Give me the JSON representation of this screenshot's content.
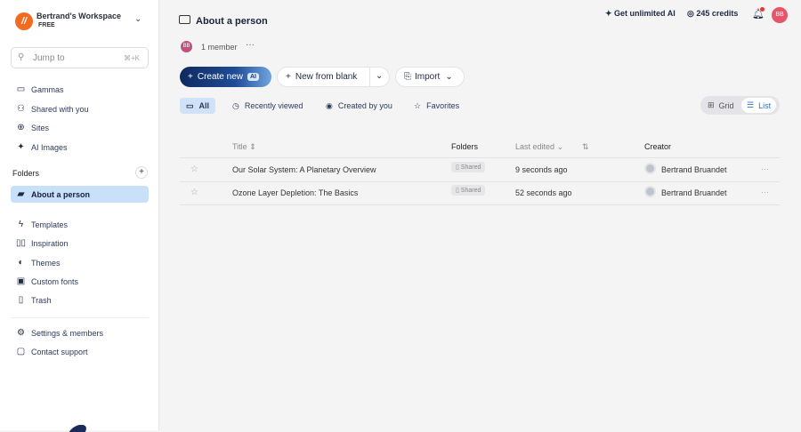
{
  "workspace": {
    "name": "Bertrand's Workspace",
    "plan": "FREE",
    "logo_letter": "g"
  },
  "search": {
    "placeholder": "Jump to",
    "shortcut": "⌘+K"
  },
  "nav": [
    {
      "label": "Gammas"
    },
    {
      "label": "Shared with you"
    },
    {
      "label": "Sites"
    },
    {
      "label": "AI Images"
    }
  ],
  "folders": {
    "heading": "Folders",
    "items": [
      {
        "label": "About a person"
      }
    ]
  },
  "nav2": [
    {
      "label": "Templates"
    },
    {
      "label": "Inspiration"
    },
    {
      "label": "Themes"
    },
    {
      "label": "Custom fonts"
    },
    {
      "label": "Trash"
    }
  ],
  "nav3": [
    {
      "label": "Settings & members"
    },
    {
      "label": "Contact support"
    }
  ],
  "header": {
    "title": "About a person",
    "member_initials": "BB",
    "members": "1 member",
    "get_ai": "Get unlimited AI",
    "credits": "245 credits",
    "user_initials": "BB"
  },
  "actions": {
    "create": "Create new",
    "ai_badge": "AI",
    "blank": "New from blank",
    "import": "Import"
  },
  "tabs": [
    {
      "label": "All"
    },
    {
      "label": "Recently viewed"
    },
    {
      "label": "Created by you"
    },
    {
      "label": "Favorites"
    }
  ],
  "view": {
    "grid": "Grid",
    "list": "List",
    "selected": "List"
  },
  "table": {
    "headers": {
      "title": "Title",
      "folders": "Folders",
      "last_edited": "Last edited",
      "creator": "Creator"
    },
    "rows": [
      {
        "title": "Our Solar System: A Planetary Overview",
        "folder": "Shared",
        "edited": "9 seconds ago",
        "creator": "Bertrand Bruandet"
      },
      {
        "title": "Ozone Layer Depletion: The Basics",
        "folder": "Shared",
        "edited": "52 seconds ago",
        "creator": "Bertrand Bruandet"
      }
    ]
  }
}
